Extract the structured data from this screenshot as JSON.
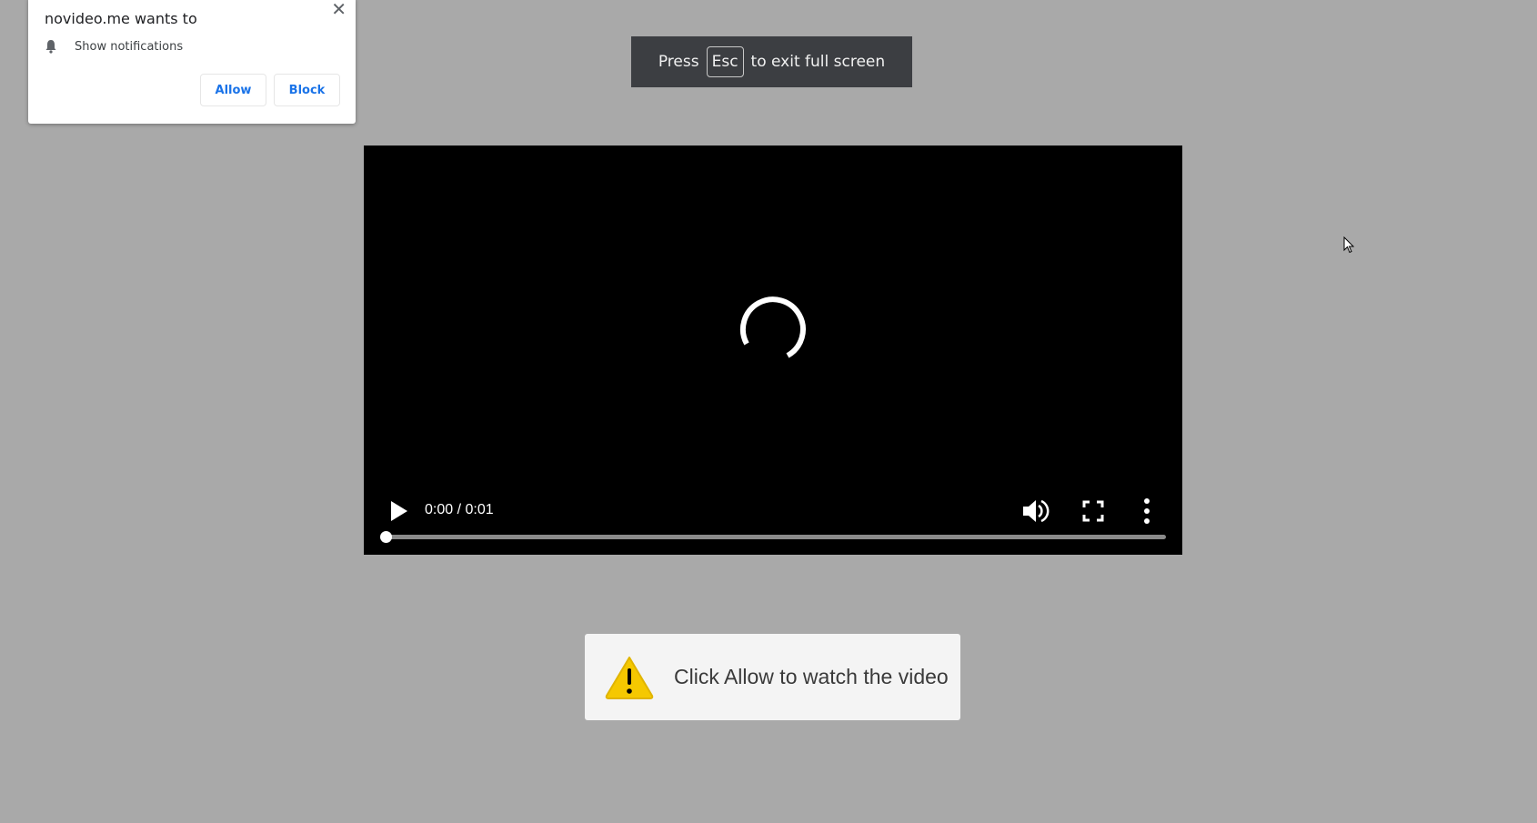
{
  "notification_prompt": {
    "title": "novideo.me wants to",
    "permission_icon": "bell-icon",
    "permission_label": "Show notifications",
    "allow_label": "Allow",
    "block_label": "Block",
    "close_symbol": "✕",
    "accent_color": "#1a73e8"
  },
  "fullscreen_toast": {
    "prefix": "Press",
    "key": "Esc",
    "suffix": "to exit full screen"
  },
  "video_player": {
    "state": "loading",
    "time_display": "0:00 / 0:01",
    "progress_fraction": 0,
    "icons": [
      "play-icon",
      "volume-icon",
      "fullscreen-icon",
      "more-options-icon",
      "loading-spinner-icon"
    ]
  },
  "info_box": {
    "icon": "warning-icon",
    "message": "Click Allow to watch the video",
    "warning_color": "#f5c800"
  }
}
